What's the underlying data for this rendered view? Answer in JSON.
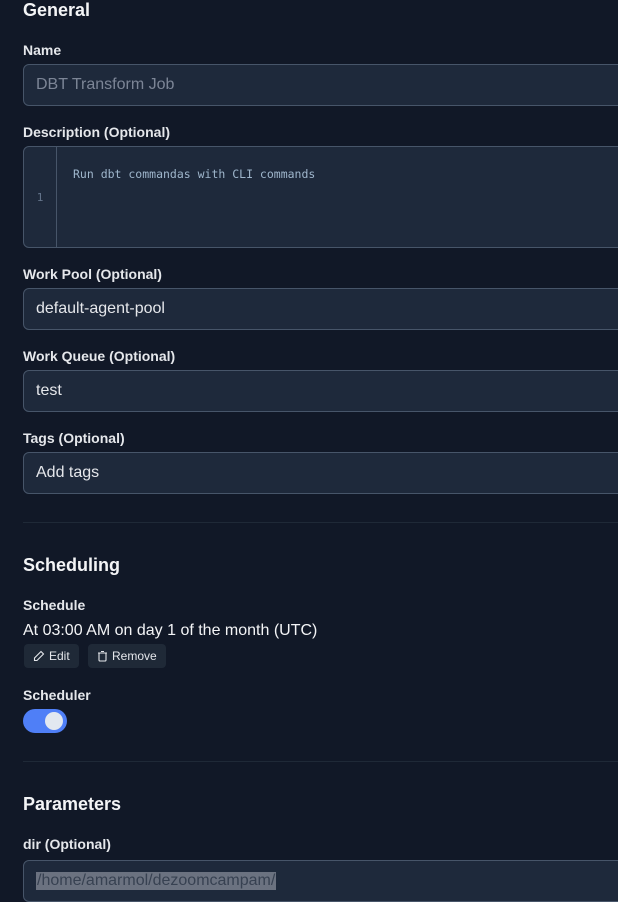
{
  "general": {
    "heading": "General",
    "name": {
      "label": "Name",
      "placeholder": "DBT Transform Job"
    },
    "description": {
      "label": "Description (Optional)",
      "line_number": "1",
      "value": "Run dbt commandas with CLI commands"
    },
    "work_pool": {
      "label": "Work Pool (Optional)",
      "value": "default-agent-pool"
    },
    "work_queue": {
      "label": "Work Queue (Optional)",
      "value": "test"
    },
    "tags": {
      "label": "Tags (Optional)",
      "placeholder": "Add tags"
    }
  },
  "scheduling": {
    "heading": "Scheduling",
    "schedule_label": "Schedule",
    "schedule_value": "At 03:00 AM on day 1 of the month (UTC)",
    "edit_label": "Edit",
    "remove_label": "Remove",
    "scheduler_label": "Scheduler",
    "scheduler_on": true,
    "toggle_color": "#4f7ff7"
  },
  "parameters": {
    "heading": "Parameters",
    "dir": {
      "label": "dir (Optional)",
      "value": "/home/amarmol/dezoomcampam/"
    }
  }
}
